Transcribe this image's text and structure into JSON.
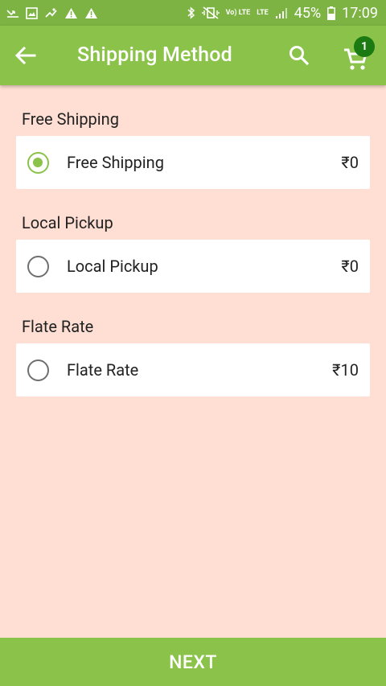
{
  "status_bar": {
    "lte_small": "Vo) LTE",
    "lte2_small": "LTE",
    "battery": "45%",
    "time": "17:09"
  },
  "app_bar": {
    "title": "Shipping Method",
    "cart_count": "1",
    "color": "#8bc34a"
  },
  "shipping_groups": [
    {
      "heading": "Free Shipping",
      "option_label": "Free Shipping",
      "price": "₹0",
      "selected": true
    },
    {
      "heading": "Local Pickup",
      "option_label": "Local Pickup",
      "price": "₹0",
      "selected": false
    },
    {
      "heading": "Flate Rate",
      "option_label": "Flate Rate",
      "price": "₹10",
      "selected": false
    }
  ],
  "footer": {
    "next_label": "NEXT"
  }
}
